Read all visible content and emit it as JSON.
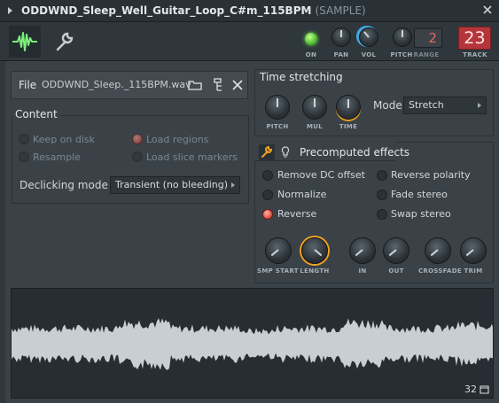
{
  "window": {
    "title": "ODDWND_Sleep_Well_Guitar_Loop_C#m_115BPM",
    "subtitle": "(SAMPLE)"
  },
  "toolbar": {
    "on_label": "ON",
    "pan_label": "PAN",
    "vol_label": "VOL",
    "pitch_label": "PITCH",
    "range_label": "RANGE",
    "track_label": "TRACK",
    "range_value": "2",
    "track_value": "23",
    "icons": [
      "waveform-icon",
      "wrench-icon"
    ]
  },
  "file": {
    "label": "File",
    "name": "ODDWND_Sleep._115BPM.wav"
  },
  "content": {
    "legend": "Content",
    "options": [
      {
        "label": "Keep on disk",
        "checked": false,
        "enabled": false
      },
      {
        "label": "Load regions",
        "checked": true,
        "enabled": false
      },
      {
        "label": "Resample",
        "checked": false,
        "enabled": false
      },
      {
        "label": "Load slice markers",
        "checked": false,
        "enabled": false
      }
    ],
    "declicking_label": "Declicking mode",
    "declicking_value": "Transient (no bleeding)"
  },
  "time_stretching": {
    "legend": "Time stretching",
    "knobs": [
      "PITCH",
      "MUL",
      "TIME"
    ],
    "mode_label": "Mode",
    "mode_value": "Stretch"
  },
  "precomputed": {
    "legend": "Precomputed effects",
    "effects": [
      {
        "label": "Remove DC offset",
        "on": false
      },
      {
        "label": "Reverse polarity",
        "on": false
      },
      {
        "label": "Normalize",
        "on": false
      },
      {
        "label": "Fade stereo",
        "on": false
      },
      {
        "label": "Reverse",
        "on": true
      },
      {
        "label": "Swap stereo",
        "on": false
      }
    ],
    "knobs": [
      "SMP START",
      "LENGTH",
      "IN",
      "OUT",
      "CROSSFADE",
      "TRIM"
    ]
  },
  "waveform": {
    "marker": "32"
  },
  "colors": {
    "accent_orange": "#f0a020",
    "accent_blue": "#3fa9e0",
    "on_green": "#6fda4c",
    "track_red": "#b5363a"
  }
}
